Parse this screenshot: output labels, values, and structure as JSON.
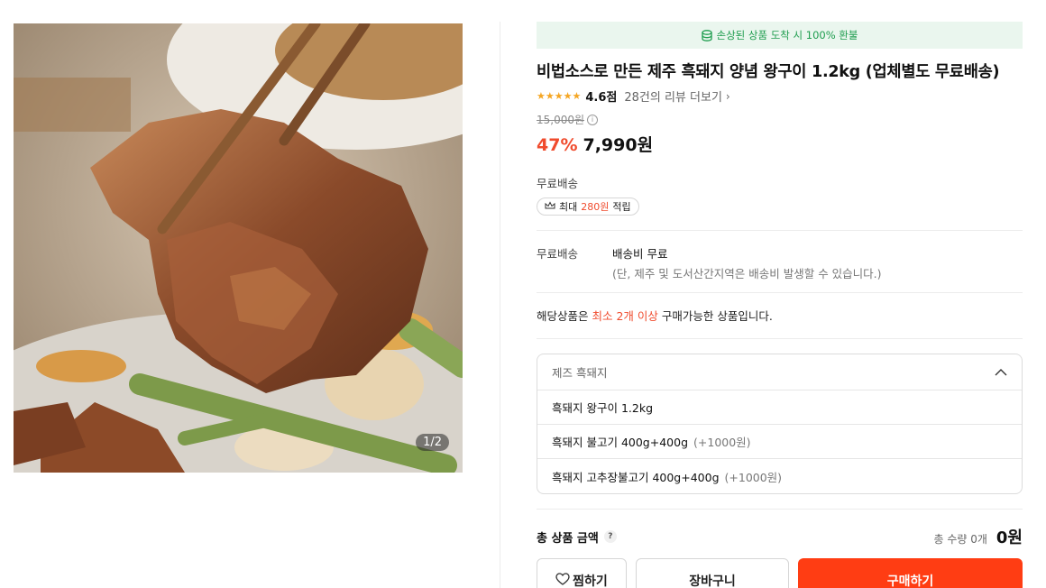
{
  "image": {
    "counter": "1/2"
  },
  "banner": {
    "text": "손상된 상품 도착 시 100% 환불",
    "icon": "coin-icon",
    "color": "#1f9d4f"
  },
  "product": {
    "title": "비법소스로 만든 제주 흑돼지 양념 왕구이 1.2kg (업체별도 무료배송)",
    "rating": 4.6,
    "rating_label": "4.6점",
    "review_link": "28건의 리뷰 더보기",
    "original_price": "15,000원",
    "discount": "47%",
    "price": "7,990원"
  },
  "shipping": {
    "label": "무료배송",
    "points_prefix": "최대",
    "points_value": "280원",
    "points_suffix": "적립",
    "detail_key": "무료배송",
    "detail_value": "배송비 무료",
    "detail_note": "(단, 제주 및 도서산간지역은 배송비 발생할 수 있습니다.)"
  },
  "min_order": {
    "prefix": "해당상품은",
    "highlight": "최소 2개 이상",
    "suffix": "구매가능한 상품입니다."
  },
  "options": {
    "header": "제즈 흑돼지",
    "items": [
      {
        "name": "흑돼지 왕구이 1.2kg",
        "extra": ""
      },
      {
        "name": "흑돼지 불고기 400g+400g",
        "extra": "(+1000원)"
      },
      {
        "name": "흑돼지 고추장불고기 400g+400g",
        "extra": "(+1000원)"
      }
    ]
  },
  "total": {
    "label": "총 상품 금액",
    "help": "?",
    "qty": "총 수량 0개",
    "amount": "0원"
  },
  "buttons": {
    "wish": "찜하기",
    "cart": "장바구니",
    "buy": "구매하기"
  },
  "colors": {
    "accent": "#ff3d13",
    "highlight": "#f04b2d",
    "star": "#f5a623"
  }
}
